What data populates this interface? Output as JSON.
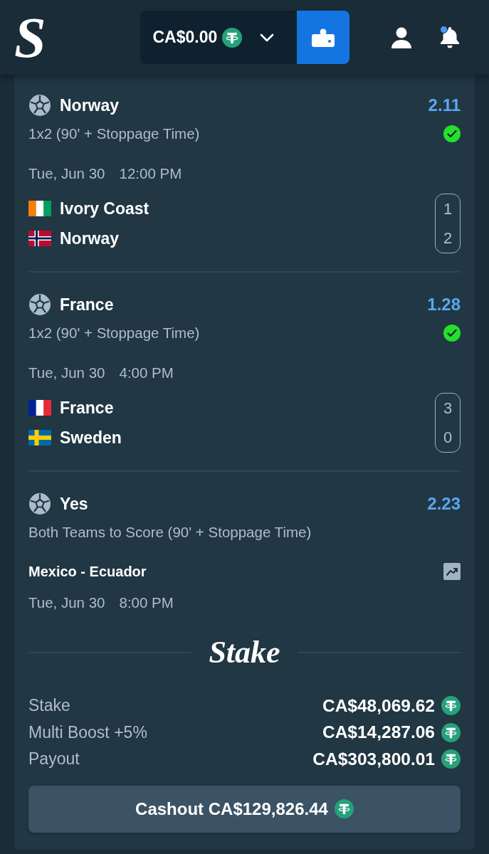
{
  "header": {
    "logo": "S",
    "balance": "CA$0.00",
    "unread": true
  },
  "legs": [
    {
      "kind": "scored",
      "title": "Norway",
      "odds": "2.11",
      "market": "1x2 (90' + Stoppage Time)",
      "won": true,
      "date": "Tue, Jun 30",
      "time": "12:00 PM",
      "teams": [
        {
          "name": "Ivory Coast",
          "score": "1",
          "flag": {
            "kind": "vertical-tricolor",
            "parts": [
              {
                "color": "#f77f00"
              },
              {
                "color": "#ffffff"
              },
              {
                "color": "#009e60"
              }
            ]
          }
        },
        {
          "name": "Norway",
          "score": "2",
          "flag": {
            "kind": "nordic-cross",
            "parts": [
              {
                "color": "#ba0c2f"
              },
              {
                "color": "#ffffff"
              },
              {
                "color": "#00205b"
              }
            ]
          }
        }
      ]
    },
    {
      "kind": "scored",
      "title": "France",
      "odds": "1.28",
      "market": "1x2 (90' + Stoppage Time)",
      "won": true,
      "date": "Tue, Jun 30",
      "time": "4:00 PM",
      "teams": [
        {
          "name": "France",
          "score": "3",
          "flag": {
            "kind": "vertical-tricolor",
            "parts": [
              {
                "color": "#002395"
              },
              {
                "color": "#ffffff"
              },
              {
                "color": "#ed2939"
              }
            ]
          }
        },
        {
          "name": "Sweden",
          "score": "0",
          "flag": {
            "kind": "nordic-cross",
            "parts": [
              {
                "color": "#006aa7"
              },
              {
                "color": "#fecc00"
              }
            ]
          }
        }
      ]
    },
    {
      "kind": "pending",
      "title": "Yes",
      "odds": "2.23",
      "market": "Both Teams to Score (90' + Stoppage Time)",
      "won": false,
      "event": "Mexico - Ecuador",
      "date": "Tue, Jun 30",
      "time": "8:00 PM"
    }
  ],
  "brand": "Stake",
  "summary": [
    {
      "label": "Stake",
      "value": "CA$48,069.62"
    },
    {
      "label": "Multi Boost +5%",
      "value": "CA$14,287.06"
    },
    {
      "label": "Payout",
      "value": "CA$303,800.01"
    }
  ],
  "cashout": {
    "label": "Cashout CA$129,826.44"
  }
}
